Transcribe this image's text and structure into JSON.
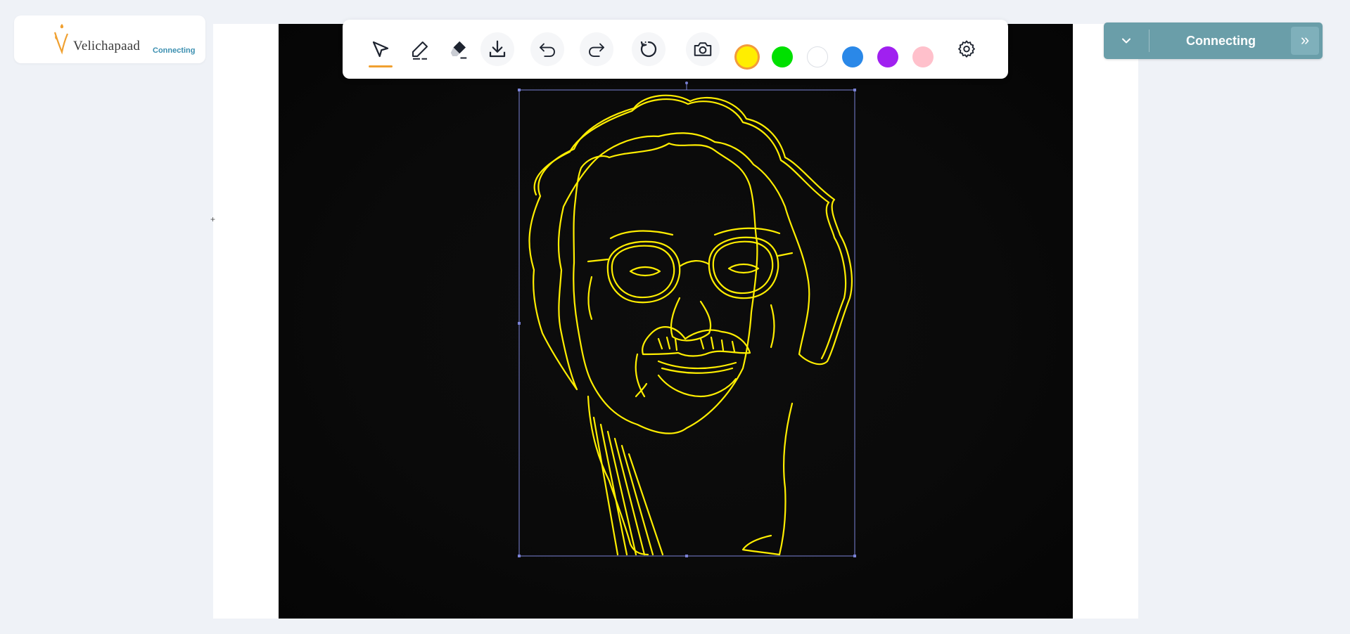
{
  "brand": {
    "name": "Velichapaad",
    "status": "Connecting",
    "accent": "#f0a030"
  },
  "toolbar": {
    "tools": [
      {
        "id": "select",
        "icon": "select-arrow-icon",
        "active": true
      },
      {
        "id": "pen",
        "icon": "pen-icon"
      },
      {
        "id": "eraser",
        "icon": "eraser-icon"
      },
      {
        "id": "download",
        "icon": "download-icon"
      },
      {
        "id": "undo",
        "icon": "undo-icon"
      },
      {
        "id": "redo",
        "icon": "redo-icon"
      },
      {
        "id": "reset",
        "icon": "reset-icon"
      },
      {
        "id": "camera",
        "icon": "camera-icon"
      },
      {
        "id": "settings",
        "icon": "gear-icon"
      }
    ],
    "colors": [
      {
        "name": "yellow",
        "hex": "#ffee00",
        "selected": true
      },
      {
        "name": "green",
        "hex": "#00e000"
      },
      {
        "name": "white",
        "hex": "#ffffff"
      },
      {
        "name": "blue",
        "hex": "#2a88e8"
      },
      {
        "name": "purple",
        "hex": "#a020f0"
      },
      {
        "name": "pink",
        "hex": "#ffc0cb"
      }
    ]
  },
  "connection": {
    "label": "Connecting",
    "expand_glyph": "»",
    "color": "#6a9ea9"
  },
  "canvas": {
    "background": "#0a0a0a",
    "stroke_color": "#ffee00",
    "selection_color": "#7a82d6"
  }
}
